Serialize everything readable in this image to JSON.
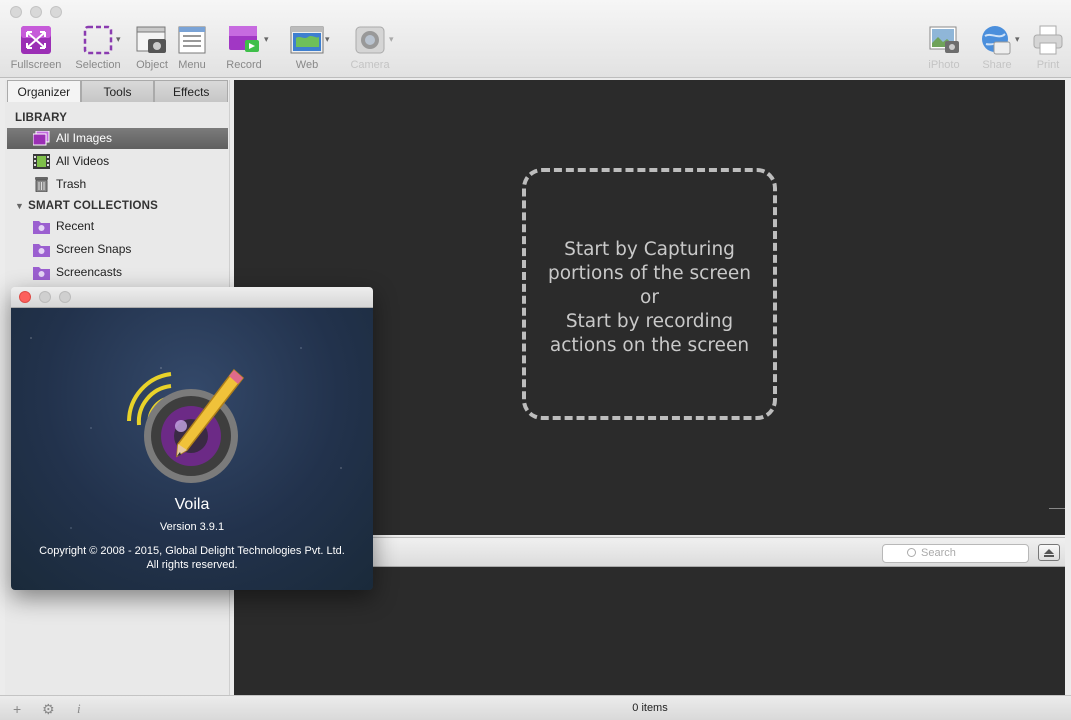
{
  "toolbar": {
    "buttons": [
      {
        "label": "Fullscreen"
      },
      {
        "label": "Selection"
      },
      {
        "label": "Object"
      },
      {
        "label": "Menu"
      },
      {
        "label": "Record"
      },
      {
        "label": "Web"
      },
      {
        "label": "Camera"
      },
      {
        "label": "iPhoto"
      },
      {
        "label": "Share"
      },
      {
        "label": "Print"
      }
    ]
  },
  "sidebar": {
    "tabs": [
      "Organizer",
      "Tools",
      "Effects"
    ],
    "library_heading": "LIBRARY",
    "library_items": [
      {
        "label": "All Images",
        "icon": "images-icon"
      },
      {
        "label": "All Videos",
        "icon": "film-icon"
      },
      {
        "label": "Trash",
        "icon": "trash-icon"
      }
    ],
    "smart_heading": "SMART COLLECTIONS",
    "smart_items": [
      {
        "label": "Recent",
        "icon": "smart-folder-icon"
      },
      {
        "label": "Screen Snaps",
        "icon": "smart-folder-icon"
      },
      {
        "label": "Screencasts",
        "icon": "smart-folder-icon"
      }
    ]
  },
  "canvas": {
    "dropzone_lines": [
      "Start by Capturing",
      "portions of the screen",
      "or",
      "Start by recording",
      "actions on the screen"
    ]
  },
  "browser": {
    "search_placeholder": "Search"
  },
  "statusbar": {
    "items_count": "0 items",
    "info_glyph": "i"
  },
  "about": {
    "app_name": "Voila",
    "version": "Version 3.9.1",
    "copyright_line1": "Copyright © 2008 - 2015, Global Delight Technologies Pvt. Ltd.",
    "copyright_line2": "All rights reserved."
  },
  "colors": {
    "canvas_bg": "#2b2b2b",
    "dropzone_border": "#bdbdbd",
    "close_red": "#fc605c",
    "accent_purple": "#9b2fb5"
  }
}
